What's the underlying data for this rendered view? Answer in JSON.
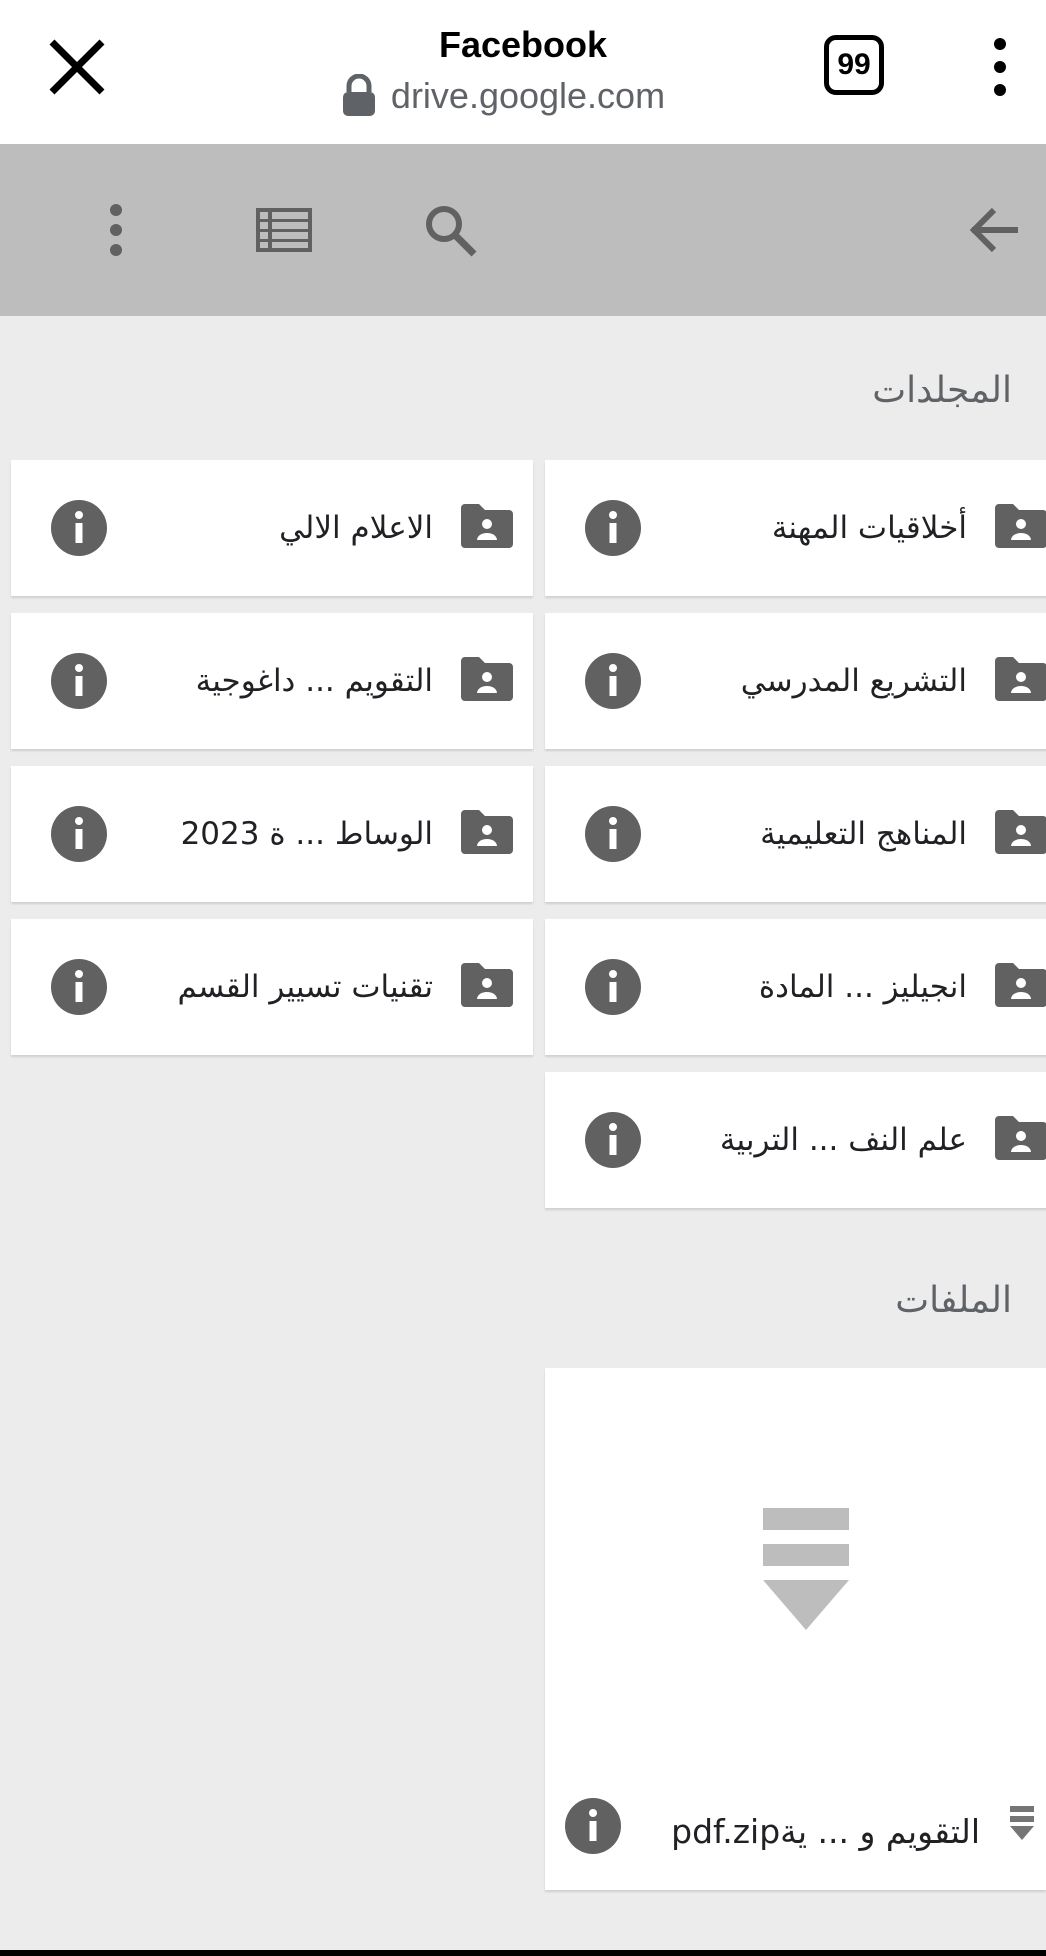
{
  "browser": {
    "title": "Facebook",
    "host": "drive.google.com",
    "tab_count": "99"
  },
  "toolbar": {
    "icons": [
      "more-vert-icon",
      "list-view-icon",
      "search-icon",
      "back-arrow-icon"
    ]
  },
  "folders_section": {
    "title": "المجلدات",
    "items": [
      {
        "label": "أخلاقيات المهنة"
      },
      {
        "label": "الاعلام الالي"
      },
      {
        "label": "التشريع المدرسي"
      },
      {
        "label": "التقويم ... داغوجية"
      },
      {
        "label": "المناهج التعليمية"
      },
      {
        "label": "الوساط ... ة 2023"
      },
      {
        "label": "انجيليز ... المادة"
      },
      {
        "label": "تقنيات تسيير القسم"
      },
      {
        "label": "علم النف ... التربية"
      }
    ]
  },
  "files_section": {
    "title": "الملفات",
    "items": [
      {
        "label": "التقويم و ... يةpdf.zip"
      }
    ]
  },
  "colors": {
    "toolbar_bg": "#bdbdbd",
    "page_bg": "#ececec",
    "icon_gray": "#616161"
  }
}
